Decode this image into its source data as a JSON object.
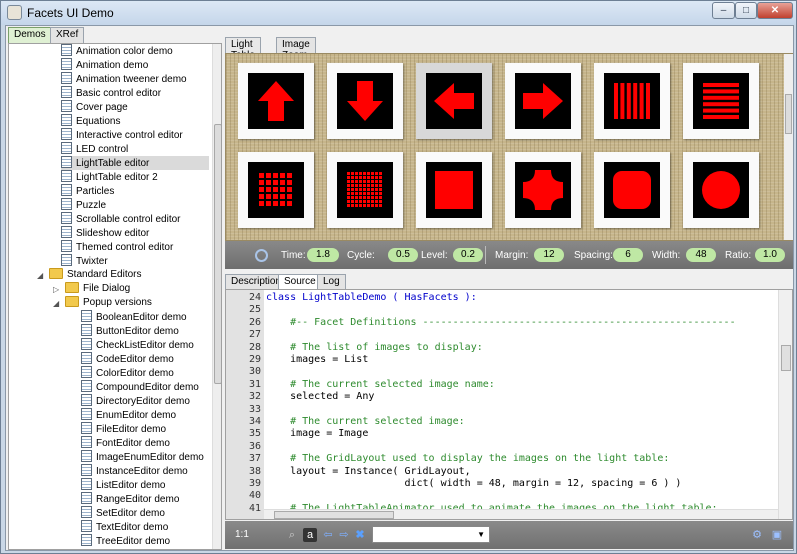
{
  "window": {
    "title": "Facets UI Demo"
  },
  "left_tabs": [
    "Demos",
    "XRef"
  ],
  "tree": {
    "items": [
      {
        "label": "Animation color demo",
        "kind": "file"
      },
      {
        "label": "Animation demo",
        "kind": "file"
      },
      {
        "label": "Animation tweener demo",
        "kind": "file"
      },
      {
        "label": "Basic control editor",
        "kind": "file"
      },
      {
        "label": "Cover page",
        "kind": "file"
      },
      {
        "label": "Equations",
        "kind": "file"
      },
      {
        "label": "Interactive control editor",
        "kind": "file"
      },
      {
        "label": "LED control",
        "kind": "file"
      },
      {
        "label": "LightTable editor",
        "kind": "file",
        "selected": true
      },
      {
        "label": "LightTable editor 2",
        "kind": "file"
      },
      {
        "label": "Particles",
        "kind": "file"
      },
      {
        "label": "Puzzle",
        "kind": "file"
      },
      {
        "label": "Scrollable control editor",
        "kind": "file"
      },
      {
        "label": "Slideshow editor",
        "kind": "file"
      },
      {
        "label": "Themed control editor",
        "kind": "file"
      },
      {
        "label": "Twixter",
        "kind": "file"
      },
      {
        "label": "Standard Editors",
        "kind": "folder"
      },
      {
        "label": "File Dialog",
        "kind": "folder"
      },
      {
        "label": "Popup versions",
        "kind": "folder"
      },
      {
        "label": "BooleanEditor demo",
        "kind": "file"
      },
      {
        "label": "ButtonEditor demo",
        "kind": "file"
      },
      {
        "label": "CheckListEditor demo",
        "kind": "file"
      },
      {
        "label": "CodeEditor demo",
        "kind": "file"
      },
      {
        "label": "ColorEditor demo",
        "kind": "file"
      },
      {
        "label": "CompoundEditor demo",
        "kind": "file"
      },
      {
        "label": "DirectoryEditor demo",
        "kind": "file"
      },
      {
        "label": "EnumEditor demo",
        "kind": "file"
      },
      {
        "label": "FileEditor demo",
        "kind": "file"
      },
      {
        "label": "FontEditor demo",
        "kind": "file"
      },
      {
        "label": "ImageEnumEditor demo",
        "kind": "file"
      },
      {
        "label": "InstanceEditor demo",
        "kind": "file"
      },
      {
        "label": "ListEditor demo",
        "kind": "file"
      },
      {
        "label": "RangeEditor demo",
        "kind": "file"
      },
      {
        "label": "SetEditor demo",
        "kind": "file"
      },
      {
        "label": "TextEditor demo",
        "kind": "file"
      },
      {
        "label": "TreeEditor demo",
        "kind": "file"
      }
    ]
  },
  "top_tabs": [
    "Light Table",
    "Image Zoom"
  ],
  "light_table": {
    "tiles": [
      "arrow-up",
      "arrow-down",
      "arrow-left",
      "arrow-right",
      "vertical-bars",
      "horizontal-bars",
      "small-grid",
      "fine-grid",
      "square",
      "rounded-cross",
      "rounded-square",
      "circle"
    ],
    "selected_tile": 2,
    "colors": {
      "shape": "#ff0000",
      "background": "#000000"
    }
  },
  "params": [
    {
      "label": "Time:",
      "value": "1.8"
    },
    {
      "label": "Cycle:",
      "value": "0.5"
    },
    {
      "label": "Level:",
      "value": "0.2"
    },
    {
      "label": "Margin:",
      "value": "12"
    },
    {
      "label": "Spacing:",
      "value": "6"
    },
    {
      "label": "Width:",
      "value": "48"
    },
    {
      "label": "Ratio:",
      "value": "1.0"
    }
  ],
  "bottom_tabs": [
    "Description",
    "Source",
    "Log"
  ],
  "source": {
    "lines": [
      {
        "n": "24",
        "text": "class LightTableDemo ( HasFacets ):",
        "type": "class"
      },
      {
        "n": "25",
        "text": "",
        "type": "code"
      },
      {
        "n": "26",
        "text": "    #-- Facet Definitions ----------------------------------------------------",
        "type": "comment"
      },
      {
        "n": "27",
        "text": "",
        "type": "code"
      },
      {
        "n": "28",
        "text": "    # The list of images to display:",
        "type": "comment"
      },
      {
        "n": "29",
        "text": "    images = List",
        "type": "code"
      },
      {
        "n": "30",
        "text": "",
        "type": "code"
      },
      {
        "n": "31",
        "text": "    # The current selected image name:",
        "type": "comment"
      },
      {
        "n": "32",
        "text": "    selected = Any",
        "type": "code"
      },
      {
        "n": "33",
        "text": "",
        "type": "code"
      },
      {
        "n": "34",
        "text": "    # The current selected image:",
        "type": "comment"
      },
      {
        "n": "35",
        "text": "    image = Image",
        "type": "code"
      },
      {
        "n": "36",
        "text": "",
        "type": "code"
      },
      {
        "n": "37",
        "text": "    # The GridLayout used to display the images on the light table:",
        "type": "comment"
      },
      {
        "n": "38",
        "text": "    layout = Instance( GridLayout,",
        "type": "code"
      },
      {
        "n": "39",
        "text": "                       dict( width = 48, margin = 12, spacing = 6 ) )",
        "type": "code"
      },
      {
        "n": "40",
        "text": "",
        "type": "code"
      },
      {
        "n": "41",
        "text": "    # The LightTableAnimator used to animate the images on the light table:",
        "type": "comment"
      }
    ]
  },
  "status": {
    "position": "1:1"
  }
}
